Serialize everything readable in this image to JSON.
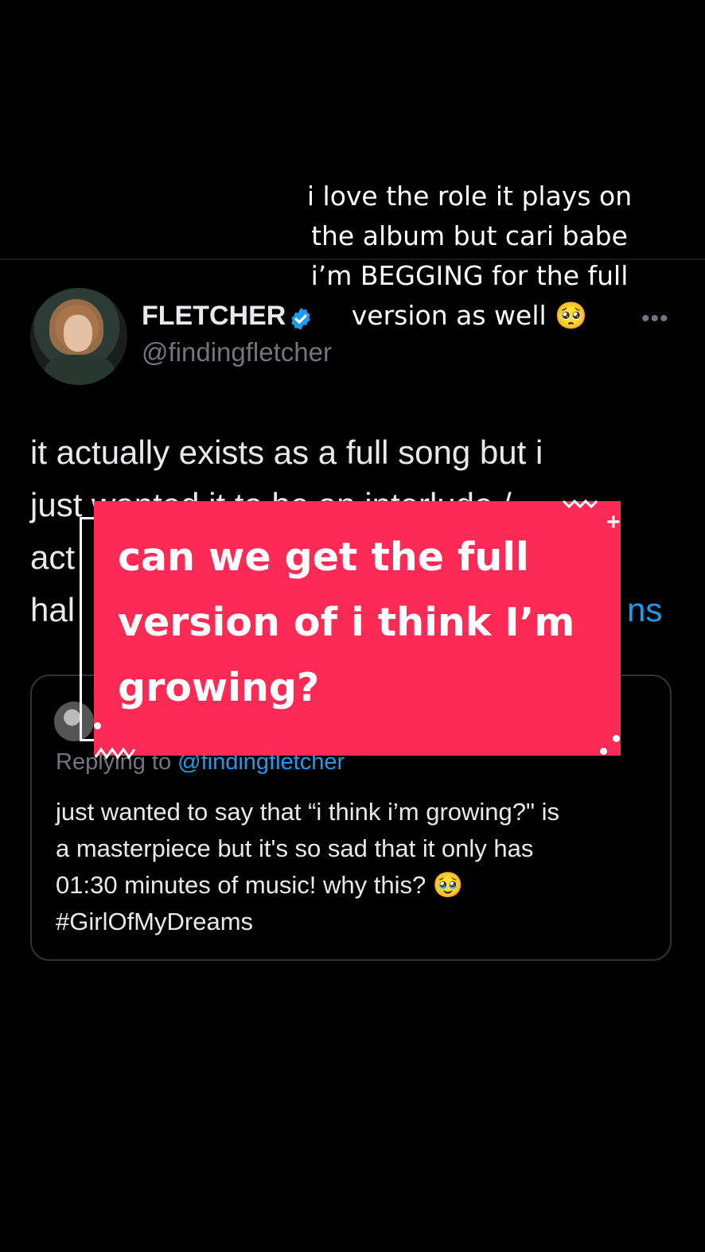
{
  "overlay": {
    "caption_lines": [
      "i love the role it plays on",
      "the album but cari babe",
      "i’m BEGGING for the full",
      "version as well 🥺"
    ]
  },
  "tweet": {
    "display_name": "FLETCHER",
    "handle": "@findingfletcher",
    "more_label": "•••",
    "text_lines": [
      "it actually exists as a full song but i",
      "just wanted it to be an interlude /",
      "act"
    ],
    "text_line3_prefix": "hal",
    "text_line3_suffix": "ns"
  },
  "quote": {
    "reply_prefix": "Replying to ",
    "reply_mention": "@findingfletcher",
    "text_lines": [
      "just wanted to say that “i think i’m growing?\" is",
      "a masterpiece but it's so sad that it only has",
      "01:30 minutes of music! why this? 🥹",
      "#GirlOfMyDreams"
    ]
  },
  "sticker": {
    "lines": [
      "can we get the full",
      "version of i think I’m",
      "growing?"
    ]
  },
  "icons": {
    "verified": "verified-badge-icon",
    "more": "more-icon"
  },
  "colors": {
    "background": "#000000",
    "sticker": "#fd2a55",
    "link": "#1d9bf0",
    "muted": "#71767b"
  }
}
